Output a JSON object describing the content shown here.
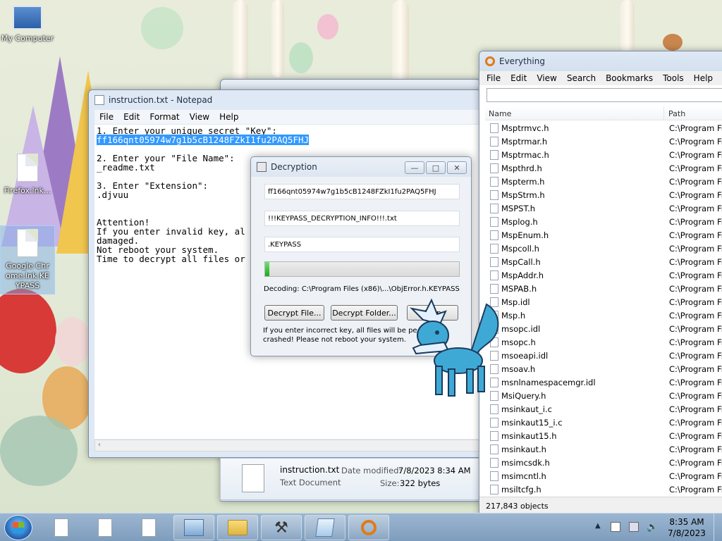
{
  "desktop": {
    "icons": [
      {
        "label": "My Computer"
      },
      {
        "label": "Firefox.lnk..."
      },
      {
        "label": "Google Chrome.lnk.KEYPASS"
      }
    ]
  },
  "notepad": {
    "title": "instruction.txt - Notepad",
    "menu": [
      "File",
      "Edit",
      "Format",
      "View",
      "Help"
    ],
    "lines": [
      "1. Enter your unique secret \"Key\":",
      "ff166qnt05974w7g1b5cB1248FZkI1fu2PAQ5FHJ",
      "",
      "2. Enter your \"File Name\":",
      "_readme.txt",
      "",
      "3. Enter \"Extension\":",
      ".djvuu",
      "",
      "",
      "Attention!",
      "If you enter invalid key, al",
      "damaged.",
      "Not reboot your system.",
      "Time to decrypt all files or"
    ],
    "key_highlight": "ff166qnt05974w7g1b5cB1248FZkI1fu2PAQ5FHJ"
  },
  "decryption": {
    "title": "Decryption",
    "key_field": "ff166qnt05974w7g1b5cB1248FZkI1fu2PAQ5FHJ",
    "filename_field": "!!!KEYPASS_DECRYPTION_INFO!!!.txt",
    "extension_field": ".KEYPASS",
    "progress": 0.02,
    "status": "Decoding: C:\\Program Files (x86)\\...\\ObjError.h.KEYPASS",
    "decrypt_file_label": "Decrypt File...",
    "decrypt_folder_label": "Decrypt Folder...",
    "stop_label": "Stop",
    "warning_line1": "If you enter incorrect key, all files will be pe",
    "warning_line2": "crashed! Please not reboot your system."
  },
  "everything": {
    "title": "Everything",
    "menu": [
      "File",
      "Edit",
      "View",
      "Search",
      "Bookmarks",
      "Tools",
      "Help"
    ],
    "col_name": "Name",
    "col_path": "Path",
    "path_value": "C:\\Program Fi",
    "rows": [
      "Msptrmvc.h",
      "Msptrmar.h",
      "Msptrmac.h",
      "Mspthrd.h",
      "Mspterm.h",
      "MspStrm.h",
      "MSPST.h",
      "Msplog.h",
      "MspEnum.h",
      "Mspcoll.h",
      "MspCall.h",
      "MspAddr.h",
      "MSPAB.h",
      "Msp.idl",
      "Msp.h",
      "msopc.idl",
      "msopc.h",
      "msoeapi.idl",
      "msoav.h",
      "msnlnamespacemgr.idl",
      "MsiQuery.h",
      "msinkaut_i.c",
      "msinkaut15_i.c",
      "msinkaut15.h",
      "msinkaut.h",
      "msimcsdk.h",
      "msimcntl.h",
      "msiltcfg.h"
    ],
    "status": "217,843 objects"
  },
  "explorer_details": {
    "filename": "instruction.txt",
    "type": "Text Document",
    "modified_label": "Date modified:",
    "modified_value": "7/8/2023 8:34 AM",
    "size_label": "Size:",
    "size_value": "322 bytes"
  },
  "taskbar": {
    "time": "8:35 AM",
    "date": "7/8/2023"
  },
  "colors": {
    "selection": "#3399ff",
    "progress_green": "#2fbf2f",
    "taskbar": "#8aa8c6"
  }
}
